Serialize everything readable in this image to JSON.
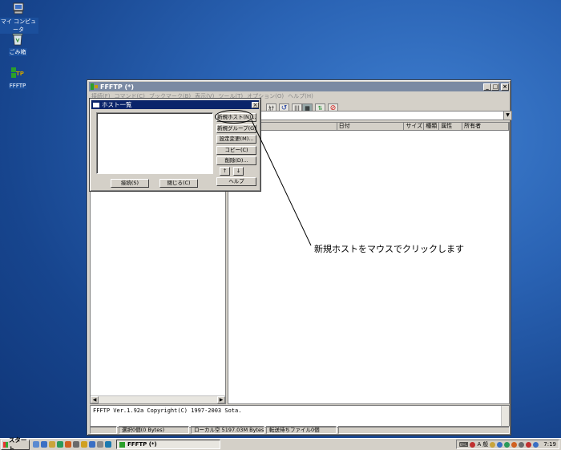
{
  "desktop": {
    "icons": [
      {
        "label": "マイ コンピュータ"
      },
      {
        "label": "ごみ箱"
      },
      {
        "label": "FFFTP"
      }
    ]
  },
  "window": {
    "title": "FFFTP (*)",
    "menu": [
      "接続(F)",
      "コマンド(C)",
      "ブックマーク(B)",
      "表示(V)",
      "ツール(T)",
      "オプション(O)",
      "ヘルプ(H)"
    ],
    "columns": [
      "日付",
      "サイズ",
      "種類",
      "属性",
      "所有者"
    ],
    "log": "FFFTP Ver.1.92a Copyright(C) 1997-2003 Sota.",
    "status": [
      "選択0個(0 Bytes)",
      "ローカル空 5197.03M Bytes",
      "転送待ちファイル0個"
    ]
  },
  "dialog": {
    "title": "ホスト一覧",
    "buttons": {
      "new_host": "新規ホスト(N)...",
      "new_group": "新規グループ(G)...",
      "edit": "設定変更(M)...",
      "copy": "コピー(C)",
      "delete": "削除(D)...",
      "up": "↑",
      "down": "↓",
      "help": "ヘルプ",
      "connect": "接続(S)",
      "close": "閉じる(C)"
    }
  },
  "annotation": {
    "text": "新規ホストをマウスでクリックします"
  },
  "taskbar": {
    "start": "スタート",
    "task": "FFFTP (*)",
    "ime_a": "A",
    "ime_mode": "般",
    "clock": "7:19"
  },
  "colors": {
    "desktop": "#2a63b4",
    "title_inactive": "#7b8aa3",
    "title_active": "#0a246a"
  }
}
